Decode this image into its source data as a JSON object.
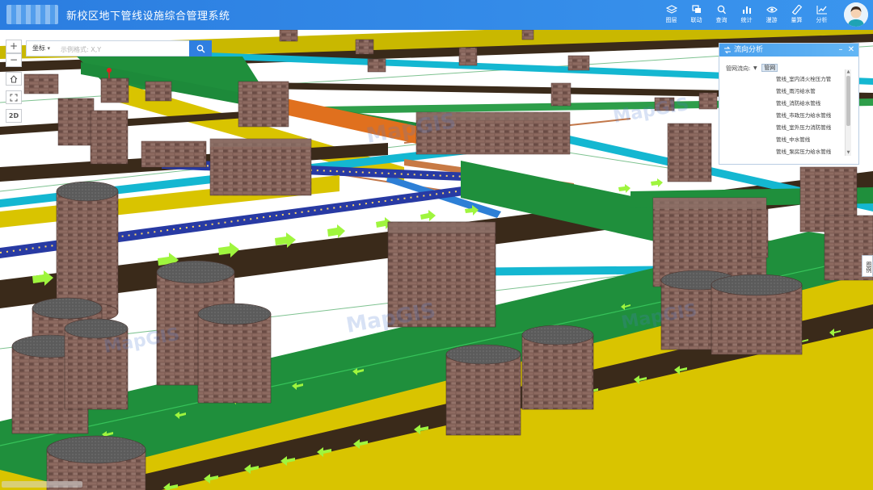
{
  "header": {
    "title": "新校区地下管线设施综合管理系统",
    "toolbar": [
      {
        "label": "图层",
        "icon": "layers-icon"
      },
      {
        "label": "联动",
        "icon": "link-windows-icon"
      },
      {
        "label": "查询",
        "icon": "search-icon"
      },
      {
        "label": "统计",
        "icon": "bar-chart-icon"
      },
      {
        "label": "漫游",
        "icon": "eye-icon"
      },
      {
        "label": "量算",
        "icon": "ruler-icon"
      },
      {
        "label": "分析",
        "icon": "line-chart-icon"
      }
    ]
  },
  "map_controls": {
    "zoom_in": "+",
    "zoom_out": "−",
    "mode_2d": "2D"
  },
  "search": {
    "type_label": "坐标",
    "placeholder": "示例格式: X,Y"
  },
  "panel": {
    "title": "流向分析",
    "direction_label": "管网流向:",
    "root_label": "管网",
    "items": [
      "管线_室内消火栓压力管",
      "管线_雨污给水管",
      "管线_消防给水管线",
      "管线_市政压力给水管线",
      "管线_室外压力消防管线",
      "管线_中水管线",
      "管线_泵房压力给水管线"
    ]
  },
  "legend_tab": "图例",
  "watermark": "MapGIS",
  "colors": {
    "header": "#2f87e6",
    "pipe_green": "#1f8f3c",
    "pipe_yellow": "#d9c400",
    "pipe_brown": "#3a2a1a",
    "pipe_cyan": "#14b7d1",
    "pipe_orange": "#e0701e",
    "pipe_navy": "#283aa3",
    "flow_arrow": "#9ff53e",
    "manhole_brick": "#7a5a52"
  }
}
